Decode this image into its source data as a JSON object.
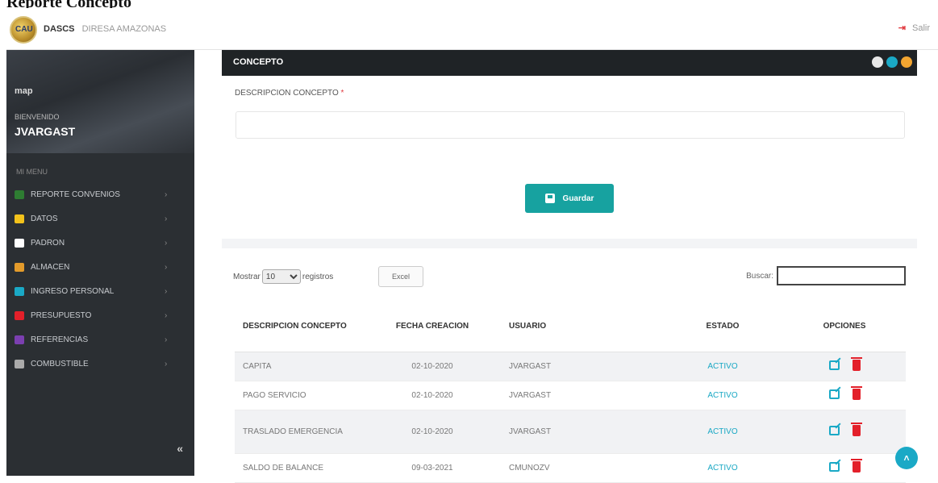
{
  "page": {
    "caption": "Reporte Concepto"
  },
  "topbar": {
    "app_name": "DASCS",
    "org_name": "DIRESA AMAZONAS",
    "logout_label": "Salir",
    "logo_text": "CAU"
  },
  "sidebar": {
    "brand": "map",
    "welcome": "BIENVENIDO",
    "username": "JVARGAST",
    "menu_title": "MI MENU",
    "collapse_glyph": "«",
    "items": [
      {
        "label": "REPORTE CONVENIOS",
        "icon": "report-icon",
        "color": "#2e7d32"
      },
      {
        "label": "DATOS",
        "icon": "database-icon",
        "color": "#f2c21b"
      },
      {
        "label": "PADRON",
        "icon": "table-icon",
        "color": "#ffffff"
      },
      {
        "label": "ALMACEN",
        "icon": "boxes-icon",
        "color": "#e39b2b"
      },
      {
        "label": "INGRESO PERSONAL",
        "icon": "user-add-icon",
        "color": "#1aa9c6"
      },
      {
        "label": "PRESUPUESTO",
        "icon": "budget-icon",
        "color": "#e3202a"
      },
      {
        "label": "REFERENCIAS",
        "icon": "reference-icon",
        "color": "#7b3fb0"
      },
      {
        "label": "COMBUSTIBLE",
        "icon": "fuel-icon",
        "color": "#aaaaaa"
      }
    ]
  },
  "panel": {
    "title": "CONCEPTO",
    "field_label": "DESCRIPCION CONCEPTO",
    "required_mark": "*",
    "description_value": "",
    "save_label": "Guardar"
  },
  "table_controls": {
    "show_prefix": "Mostrar",
    "page_size": "10",
    "show_suffix": "registros",
    "excel_label": "Excel",
    "search_label": "Buscar:",
    "search_value": ""
  },
  "table": {
    "headers": [
      "DESCRIPCION CONCEPTO",
      "FECHA CREACION",
      "USUARIO",
      "ESTADO",
      "OPCIONES"
    ],
    "rows": [
      {
        "descripcion": "CAPITA",
        "fecha": "02-10-2020",
        "usuario": "JVARGAST",
        "estado": "ACTIVO"
      },
      {
        "descripcion": "PAGO SERVICIO",
        "fecha": "02-10-2020",
        "usuario": "JVARGAST",
        "estado": "ACTIVO"
      },
      {
        "descripcion": "TRASLADO EMERGENCIA",
        "fecha": "02-10-2020",
        "usuario": "JVARGAST",
        "estado": "ACTIVO"
      },
      {
        "descripcion": "SALDO DE BALANCE",
        "fecha": "09-03-2021",
        "usuario": "CMUNOZV",
        "estado": "ACTIVO"
      }
    ]
  },
  "colors": {
    "accent": "#17a2a0",
    "status_active": "#19a8c4",
    "delete": "#e3202a"
  }
}
